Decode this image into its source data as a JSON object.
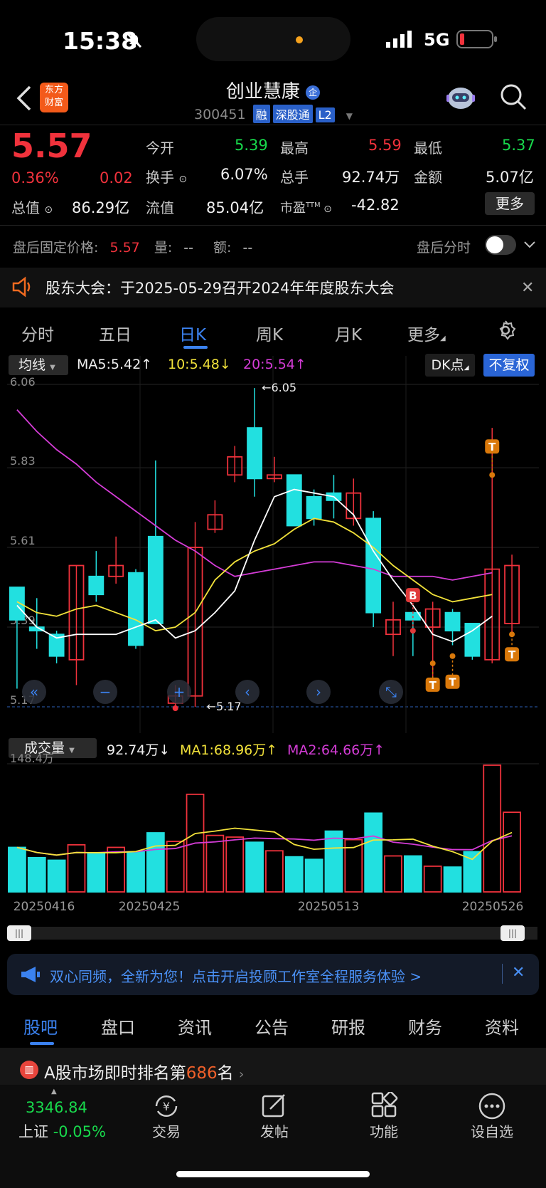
{
  "status": {
    "time": "15:38",
    "network": "5G"
  },
  "header": {
    "name": "创业慧康",
    "badge": "企",
    "code": "300451",
    "tags": [
      "融",
      "深股通",
      "L2"
    ],
    "logo_line1": "东方",
    "logo_line2": "财富"
  },
  "quote": {
    "price": "5.57",
    "pct": "0.36%",
    "chg": "0.02",
    "open_label": "今开",
    "open": "5.39",
    "high_label": "最高",
    "high": "5.59",
    "low_label": "最低",
    "low": "5.37",
    "turnover_label": "换手",
    "turnover": "6.07%",
    "volume_label": "总手",
    "volume": "92.74万",
    "amount_label": "金额",
    "amount": "5.07亿",
    "mcap_label": "总值",
    "mcap": "86.29亿",
    "float_label": "流值",
    "float": "85.04亿",
    "pe_label": "市盈",
    "pe_sup": "TTM",
    "pe": "-42.82",
    "more": "更多"
  },
  "after_hours": {
    "label": "盘后固定价格:",
    "price": "5.57",
    "vol_label": "量:",
    "vol": "--",
    "amt_label": "额:",
    "amt": "--",
    "toggle_label": "盘后分时"
  },
  "notice": {
    "text": "股东大会：于2025-05-29召开2024年年度股东大会"
  },
  "ktabs": [
    "分时",
    "五日",
    "日K",
    "周K",
    "月K",
    "更多"
  ],
  "ktab_active": 2,
  "ma_bar": {
    "select": "均线",
    "ma5": "MA5:5.42↑",
    "ma10": "10:5.48↓",
    "ma20": "20:5.54↑",
    "dk": "DK点",
    "adjust": "不复权"
  },
  "colors": {
    "up": "#f0323c",
    "down": "#22e0e0",
    "ma5": "#ffffff",
    "ma10": "#f2e23a",
    "ma20": "#d43cd6",
    "accent": "#3b82f0"
  },
  "chart_data": {
    "type": "candlestick",
    "y_ticks": [
      "6.06",
      "5.83",
      "5.61",
      "5.39",
      "5.17"
    ],
    "ylim": [
      5.17,
      6.06
    ],
    "high_marker": "←6.05",
    "low_marker": "←5.17",
    "candles": [
      {
        "o": 5.5,
        "c": 5.41,
        "h": 5.5,
        "l": 5.22
      },
      {
        "o": 5.39,
        "c": 5.38,
        "h": 5.47,
        "l": 5.33
      },
      {
        "o": 5.37,
        "c": 5.31,
        "h": 5.38,
        "l": 5.29
      },
      {
        "o": 5.3,
        "c": 5.56,
        "h": 5.56,
        "l": 5.23
      },
      {
        "o": 5.53,
        "c": 5.48,
        "h": 5.6,
        "l": 5.46
      },
      {
        "o": 5.53,
        "c": 5.56,
        "h": 5.64,
        "l": 5.51
      },
      {
        "o": 5.54,
        "c": 5.34,
        "h": 5.55,
        "l": 5.33
      },
      {
        "o": 5.64,
        "c": 5.4,
        "h": 5.85,
        "l": 5.4
      },
      {
        "o": 5.18,
        "c": 5.2,
        "h": 5.23,
        "l": 5.17
      },
      {
        "o": 5.2,
        "c": 5.61,
        "h": 5.68,
        "l": 5.17
      },
      {
        "o": 5.66,
        "c": 5.7,
        "h": 5.74,
        "l": 5.65
      },
      {
        "o": 5.81,
        "c": 5.86,
        "h": 5.89,
        "l": 5.79
      },
      {
        "o": 5.94,
        "c": 5.8,
        "h": 6.05,
        "l": 5.75
      },
      {
        "o": 5.8,
        "c": 5.81,
        "h": 5.86,
        "l": 5.79
      },
      {
        "o": 5.81,
        "c": 5.67,
        "h": 5.81,
        "l": 5.67
      },
      {
        "o": 5.75,
        "c": 5.69,
        "h": 5.77,
        "l": 5.67
      },
      {
        "o": 5.76,
        "c": 5.74,
        "h": 5.81,
        "l": 5.69
      },
      {
        "o": 5.69,
        "c": 5.76,
        "h": 5.8,
        "l": 5.67
      },
      {
        "o": 5.69,
        "c": 5.43,
        "h": 5.71,
        "l": 5.39
      },
      {
        "o": 5.37,
        "c": 5.41,
        "h": 5.46,
        "l": 5.31
      },
      {
        "o": 5.43,
        "c": 5.41,
        "h": 5.43,
        "l": 5.31
      },
      {
        "o": 5.39,
        "c": 5.44,
        "h": 5.46,
        "l": 5.25
      },
      {
        "o": 5.43,
        "c": 5.38,
        "h": 5.44,
        "l": 5.34
      },
      {
        "o": 5.4,
        "c": 5.31,
        "h": 5.4,
        "l": 5.3
      },
      {
        "o": 5.3,
        "c": 5.55,
        "h": 5.94,
        "l": 5.29
      },
      {
        "o": 5.4,
        "c": 5.56,
        "h": 5.59,
        "l": 5.37
      }
    ],
    "ma5": [
      5.45,
      5.39,
      5.36,
      5.37,
      5.37,
      5.37,
      5.39,
      5.41,
      5.36,
      5.38,
      5.43,
      5.49,
      5.63,
      5.75,
      5.77,
      5.76,
      5.75,
      5.7,
      5.6,
      5.52,
      5.45,
      5.37,
      5.35,
      5.38,
      5.42
    ],
    "ma10": [
      5.46,
      5.43,
      5.42,
      5.44,
      5.45,
      5.43,
      5.41,
      5.38,
      5.39,
      5.43,
      5.52,
      5.57,
      5.6,
      5.62,
      5.66,
      5.69,
      5.68,
      5.65,
      5.61,
      5.56,
      5.52,
      5.48,
      5.46,
      5.47,
      5.48
    ],
    "ma20": [
      5.99,
      5.93,
      5.88,
      5.84,
      5.79,
      5.75,
      5.71,
      5.67,
      5.63,
      5.6,
      5.56,
      5.53,
      5.54,
      5.55,
      5.56,
      5.57,
      5.57,
      5.56,
      5.55,
      5.53,
      5.53,
      5.53,
      5.52,
      5.53,
      5.54
    ],
    "volume_label": "成交量",
    "volume_now": "92.74万↓",
    "vol_ma1": "MA1:68.96万↑",
    "vol_ma2": "MA2:64.66万↑",
    "vol_max": "148.4万",
    "volumes": [
      52,
      40,
      37,
      55,
      45,
      52,
      47,
      69,
      59,
      114,
      66,
      64,
      58,
      48,
      41,
      38,
      71,
      61,
      92,
      42,
      42,
      30,
      29,
      47,
      148,
      93
    ],
    "x_labels": [
      "20250416",
      "20250425",
      "20250513",
      "20250526"
    ],
    "signal_b": "B",
    "signal_t": "T"
  },
  "promo": {
    "text": "双心同频，全新为您！点击开启投顾工作室全程服务体验 >"
  },
  "nav_tabs": [
    "股吧",
    "盘口",
    "资讯",
    "公告",
    "研报",
    "财务",
    "资料"
  ],
  "nav_active": 0,
  "ranking": {
    "prefix": "A股市场即时排名第",
    "rank": "686",
    "suffix": "名"
  },
  "index": {
    "value": "3346.84",
    "name": "上证",
    "pct": "-0.05%"
  },
  "bottom": [
    "交易",
    "发帖",
    "功能",
    "设自选"
  ]
}
